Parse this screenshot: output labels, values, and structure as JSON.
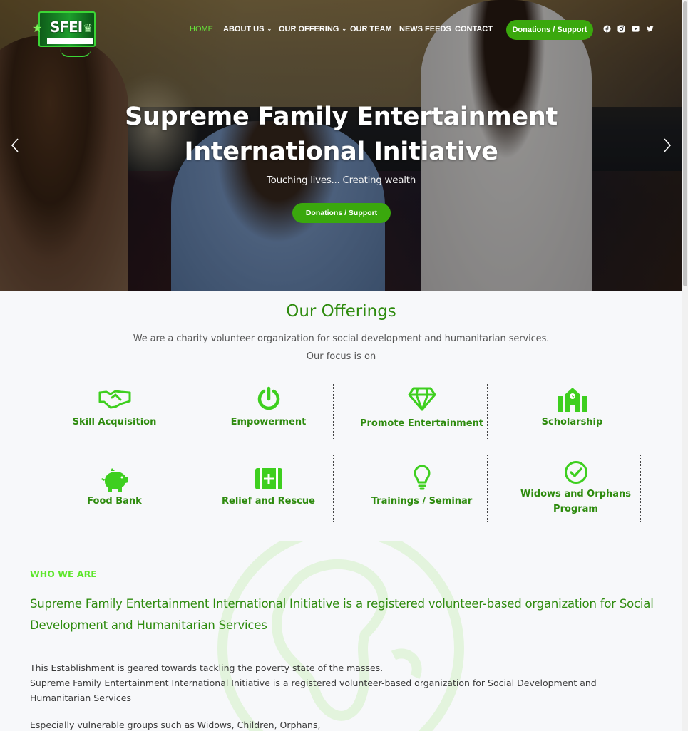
{
  "brand": {
    "logo_text": "SFEI"
  },
  "nav": {
    "items": [
      {
        "label": "HOME",
        "active": true
      },
      {
        "label": "ABOUT US",
        "dropdown": true
      },
      {
        "label": "OUR OFFERING",
        "dropdown": true
      },
      {
        "label": "OUR TEAM"
      },
      {
        "label": "NEWS FEEDS"
      },
      {
        "label": "CONTACT"
      }
    ],
    "cta": "Donations / Support",
    "social": [
      "facebook-icon",
      "instagram-icon",
      "youtube-icon",
      "twitter-icon"
    ]
  },
  "hero": {
    "title_line1": "Supreme Family Entertainment",
    "title_line2": "International Initiative",
    "subtitle": "Touching lives... Creating wealth",
    "cta": "Donations / Support"
  },
  "offerings": {
    "title": "Our Offerings",
    "description": "We are a charity volunteer organization for social development and humanitarian services.",
    "focus": "Our focus is on",
    "items": [
      {
        "label": "Skill Acquisition",
        "icon": "handshake-icon"
      },
      {
        "label": "Empowerment",
        "icon": "power-icon"
      },
      {
        "label": "Promote Entertainment",
        "icon": "diamond-icon"
      },
      {
        "label": "Scholarship",
        "icon": "school-icon"
      },
      {
        "label": "Food Bank",
        "icon": "piggy-bank-icon"
      },
      {
        "label": "Relief and Rescue",
        "icon": "first-aid-icon"
      },
      {
        "label": "Trainings / Seminar",
        "icon": "lightbulb-icon"
      },
      {
        "label": "Widows and Orphans",
        "label2": "Program",
        "icon": "check-circle-icon"
      }
    ]
  },
  "who": {
    "tag": "WHO WE ARE",
    "heading": "Supreme Family Entertainment International Initiative is a registered volunteer-based organization for Social Development and Humanitarian Services",
    "body1": "This Establishment is geared towards tackling the poverty state of the masses.",
    "body2": "Supreme Family Entertainment International Initiative is a registered volunteer-based organization for Social Development and Humanitarian Services",
    "body3": "Especially vulnerable groups such as Widows, Children, Orphans,"
  },
  "colors": {
    "accent": "#3aa80d",
    "heading_green": "#2e8b0e",
    "bright_green": "#5ee62b"
  }
}
